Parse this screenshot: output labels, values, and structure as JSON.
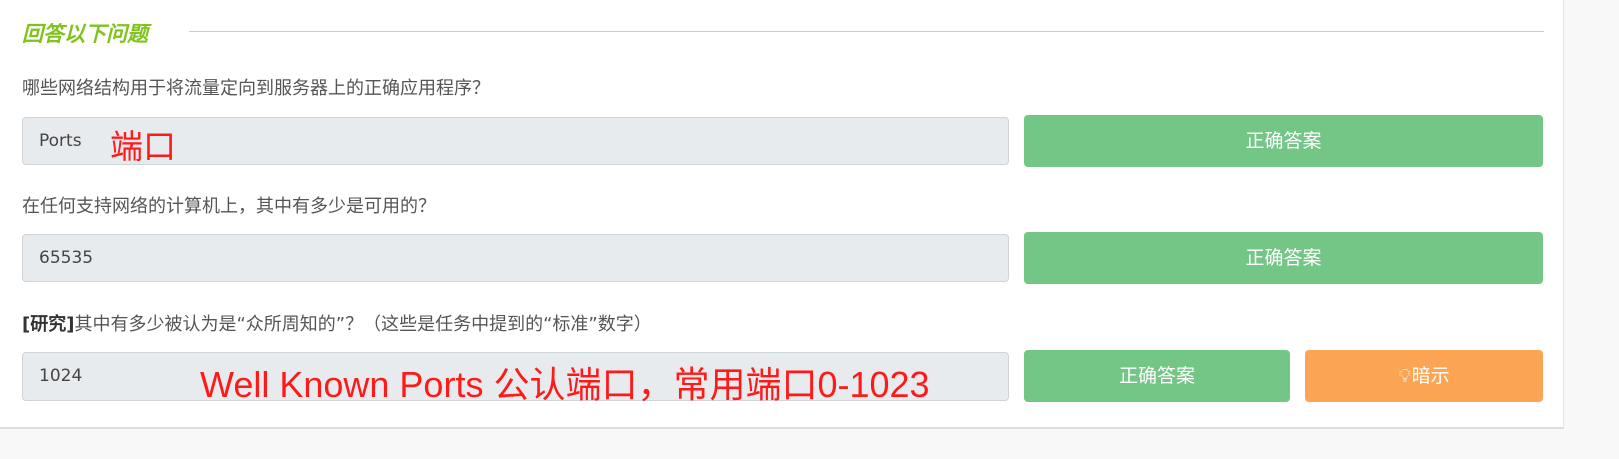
{
  "section_title": "回答以下问题",
  "questions": [
    {
      "prefix": "",
      "text": "哪些网络结构用于将流量定向到服务器上的正确应用程序？",
      "answer": "Ports",
      "annotation": "端口",
      "submit_label": "正确答案"
    },
    {
      "prefix": "",
      "text": "在任何支持网络的计算机上，其中有多少是可用的？",
      "answer": "65535",
      "submit_label": "正确答案"
    },
    {
      "prefix": "[研究]",
      "text": "其中有多少被认为是“众所周知的”？（这些是任务中提到的“标准”数字）",
      "answer": "1024",
      "annotation": "Well Known Ports 公认端口，常用端口0-1023",
      "submit_label": "正确答案",
      "hint_label": "暗示"
    }
  ],
  "colors": {
    "accent": "#80c31c",
    "success": "#74c686",
    "hint": "#fba454",
    "annotation": "#ff1a1a"
  }
}
